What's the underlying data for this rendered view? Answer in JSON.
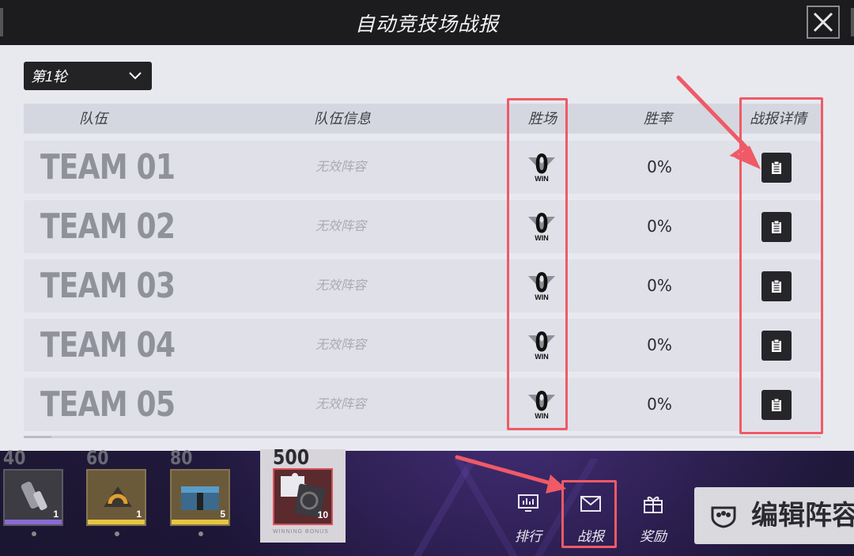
{
  "window": {
    "title": "自动竞技场战报"
  },
  "round_selector": {
    "value": "第1轮"
  },
  "table": {
    "headers": {
      "team": "队伍",
      "team_info": "队伍信息",
      "wins": "胜场",
      "win_rate": "胜率",
      "details": "战报详情"
    },
    "rows": [
      {
        "team": "TEAM 01",
        "info": "无效阵容",
        "wins": "0",
        "win_label": "WIN",
        "rate": "0%"
      },
      {
        "team": "TEAM 02",
        "info": "无效阵容",
        "wins": "0",
        "win_label": "WIN",
        "rate": "0%"
      },
      {
        "team": "TEAM 03",
        "info": "无效阵容",
        "wins": "0",
        "win_label": "WIN",
        "rate": "0%"
      },
      {
        "team": "TEAM 04",
        "info": "无效阵容",
        "wins": "0",
        "win_label": "WIN",
        "rate": "0%"
      },
      {
        "team": "TEAM 05",
        "info": "无效阵容",
        "wins": "0",
        "win_label": "WIN",
        "rate": "0%"
      }
    ]
  },
  "rewards": [
    {
      "threshold": "40",
      "count": "1"
    },
    {
      "threshold": "60",
      "count": "1"
    },
    {
      "threshold": "80",
      "count": "5"
    }
  ],
  "big_reward": {
    "threshold": "500",
    "count": "10",
    "caption": "WINNING BONUS"
  },
  "bottom_nav": {
    "ranking": "排行",
    "report": "战报",
    "rewards": "奖励",
    "edit_lineup": "编辑阵容"
  },
  "colors": {
    "highlight": "#ef5a66",
    "panel_bg": "#e8e9ef",
    "title_bar": "#1c1c1f"
  }
}
